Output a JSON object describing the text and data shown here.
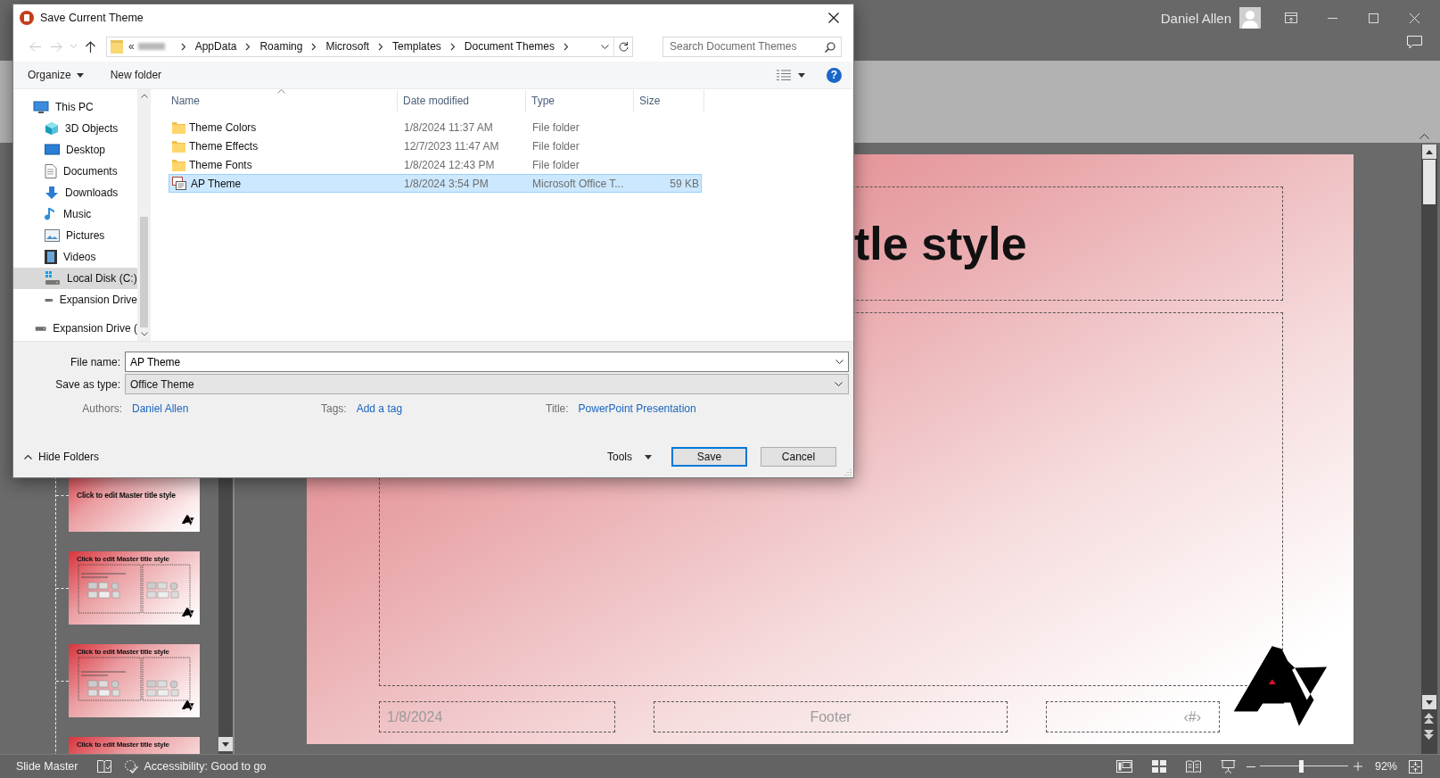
{
  "window": {
    "user": "Daniel Allen"
  },
  "thumbnails": [
    {
      "kind": "title_slide",
      "title": "Click to edit Master title style"
    },
    {
      "kind": "two_content",
      "title": "Click to edit Master title style"
    },
    {
      "kind": "comparison",
      "title": "Click to edit Master title style"
    },
    {
      "kind": "title_only",
      "title": "Click to edit Master title style"
    }
  ],
  "slide": {
    "title": "tle style",
    "date": "1/8/2024",
    "footer": "Footer",
    "slide_number": "‹#›"
  },
  "status_bar": {
    "view": "Slide Master",
    "accessibility": "Accessibility: Good to go",
    "zoom_slider": {
      "level": 0.47
    },
    "zoom": "92%"
  },
  "dialog": {
    "title": "Save Current Theme",
    "path_overflow": "«",
    "path": [
      "AppData",
      "Roaming",
      "Microsoft",
      "Templates",
      "Document Themes"
    ],
    "search": {
      "placeholder": "Search Document Themes"
    },
    "toolbar": {
      "organize": "Organize",
      "new_folder": "New folder",
      "help": "?"
    },
    "nav_items": [
      {
        "label": "This PC",
        "kind": "pc",
        "selected": false,
        "children": [
          {
            "label": "3D Objects",
            "kind": "objects",
            "selected": false
          },
          {
            "label": "Desktop",
            "kind": "desktop",
            "selected": false
          },
          {
            "label": "Documents",
            "kind": "documents",
            "selected": false
          },
          {
            "label": "Downloads",
            "kind": "downloads",
            "selected": false
          },
          {
            "label": "Music",
            "kind": "music",
            "selected": false
          },
          {
            "label": "Pictures",
            "kind": "pictures",
            "selected": false
          },
          {
            "label": "Videos",
            "kind": "videos",
            "selected": false
          },
          {
            "label": "Local Disk (C:)",
            "kind": "disk",
            "selected": true
          },
          {
            "label": "Expansion Drive",
            "kind": "drive",
            "selected": false
          }
        ]
      },
      {
        "label": "Expansion Drive (",
        "kind": "drive",
        "selected": false
      }
    ],
    "columns": [
      "Name",
      "Date modified",
      "Type",
      "Size"
    ],
    "files": [
      {
        "name": "Theme Colors",
        "date": "1/8/2024 11:37 AM",
        "type": "File folder",
        "kind": "folder",
        "selected": false
      },
      {
        "name": "Theme Effects",
        "date": "12/7/2023 11:47 AM",
        "type": "File folder",
        "kind": "folder",
        "selected": false
      },
      {
        "name": "Theme Fonts",
        "date": "1/8/2024 12:43 PM",
        "type": "File folder",
        "kind": "folder",
        "selected": false
      },
      {
        "name": "AP Theme",
        "date": "1/8/2024 3:54 PM",
        "type": "Microsoft Office T...",
        "size": "59 KB",
        "kind": "theme",
        "selected": true
      }
    ],
    "file_name": {
      "label": "File name:",
      "value": "AP Theme"
    },
    "save_as_type": {
      "label": "Save as type:",
      "value": "Office Theme"
    },
    "meta": [
      {
        "label": "Authors:",
        "value": "Daniel Allen"
      },
      {
        "label": "Tags:",
        "value": "Add a tag"
      },
      {
        "label": "Title:",
        "value": "PowerPoint Presentation"
      }
    ],
    "hide_folders": "Hide Folders",
    "tools": "Tools",
    "buttons": [
      {
        "label": "Save",
        "kind": "primary"
      },
      {
        "label": "Cancel",
        "kind": "normal"
      }
    ]
  }
}
